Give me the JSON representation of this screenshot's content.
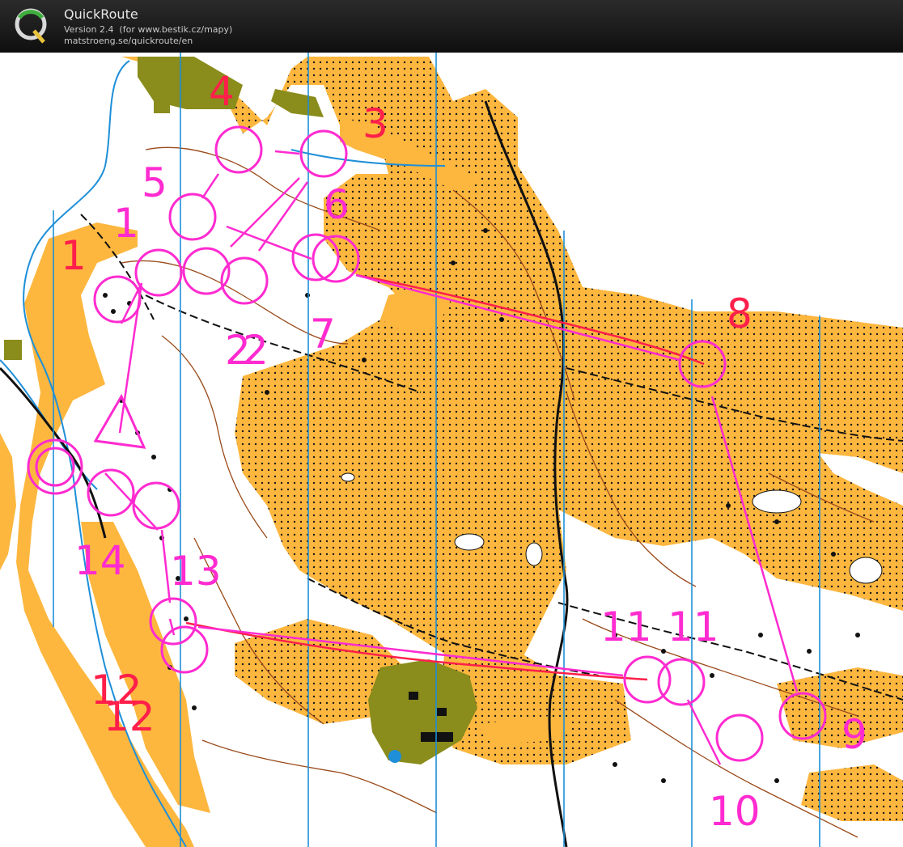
{
  "app": {
    "title": "QuickRoute",
    "version": "Version 2.4  (for www.bestik.cz/mapy)",
    "url": "matstroeng.se/quickroute/en",
    "logo_letter": "Q"
  },
  "colors": {
    "course": "#ff2bd0",
    "route": "#ff1f4a",
    "open_land": "#fdb73f",
    "settlement": "#8a8c1c",
    "contour": "#9a4a1a",
    "water": "#1e8fd8",
    "north_lines": "#1e8fd8"
  },
  "map": {
    "controls": [
      {
        "id": "start",
        "label": "",
        "type": "start-triangle"
      },
      {
        "id": "c1",
        "label": "1"
      },
      {
        "id": "c2",
        "label": "2"
      },
      {
        "id": "c2b",
        "label": "2"
      },
      {
        "id": "c3",
        "label": "3"
      },
      {
        "id": "c4",
        "label": "4"
      },
      {
        "id": "c5",
        "label": "5"
      },
      {
        "id": "c6",
        "label": "6"
      },
      {
        "id": "c7",
        "label": "7"
      },
      {
        "id": "c8",
        "label": "8"
      },
      {
        "id": "c9",
        "label": "9"
      },
      {
        "id": "c10",
        "label": "10"
      },
      {
        "id": "c11a",
        "label": "11"
      },
      {
        "id": "c11b",
        "label": "11"
      },
      {
        "id": "c12a",
        "label": "12"
      },
      {
        "id": "c12b",
        "label": "12"
      },
      {
        "id": "c13",
        "label": "13"
      },
      {
        "id": "c14",
        "label": "14"
      },
      {
        "id": "c1b",
        "label": "1"
      },
      {
        "id": "finish",
        "label": "",
        "type": "finish"
      }
    ]
  }
}
